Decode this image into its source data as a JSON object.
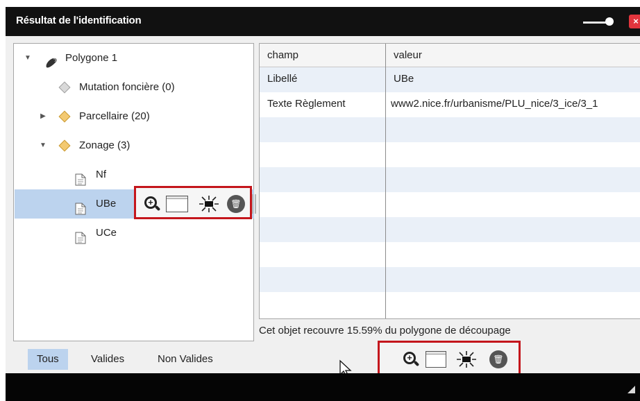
{
  "window": {
    "title": "Résultat de l'identification",
    "close_symbol": "×"
  },
  "tree": {
    "nodes": [
      {
        "label": "Polygone 1",
        "toggle": "▼",
        "icon": "polygon-icon"
      },
      {
        "label": "Mutation foncière (0)",
        "toggle": "",
        "icon": "grey-diamond-icon"
      },
      {
        "label": "Parcellaire (20)",
        "toggle": "▶",
        "icon": "gold-diamond-icon"
      },
      {
        "label": "Zonage (3)",
        "toggle": "▼",
        "icon": "gold-diamond-icon"
      },
      {
        "label": "Nf",
        "toggle": "",
        "icon": "document-icon"
      },
      {
        "label": "UBe",
        "toggle": "",
        "icon": "document-icon",
        "selected": true
      },
      {
        "label": "UCe",
        "toggle": "",
        "icon": "document-icon"
      }
    ]
  },
  "toolbar_icons": [
    "zoom-in-icon",
    "window-icon",
    "highlight-icon",
    "trash-icon"
  ],
  "grid": {
    "columns": [
      "champ",
      "valeur"
    ],
    "rows": [
      {
        "champ": "Libellé",
        "valeur": "UBe"
      },
      {
        "champ": "Texte Règlement",
        "valeur": "www2.nice.fr/urbanisme/PLU_nice/3_ice/3_1"
      }
    ]
  },
  "coverage_text": "Cet objet recouvre 15.59%  du polygone de découpage",
  "filters": {
    "tabs": [
      "Tous",
      "Valides",
      "Non Valides"
    ],
    "active": "Tous"
  },
  "colors": {
    "highlight_box": "#c4161c",
    "selection": "#bcd3ee",
    "titlebar": "#111111",
    "close": "#e2353d"
  }
}
